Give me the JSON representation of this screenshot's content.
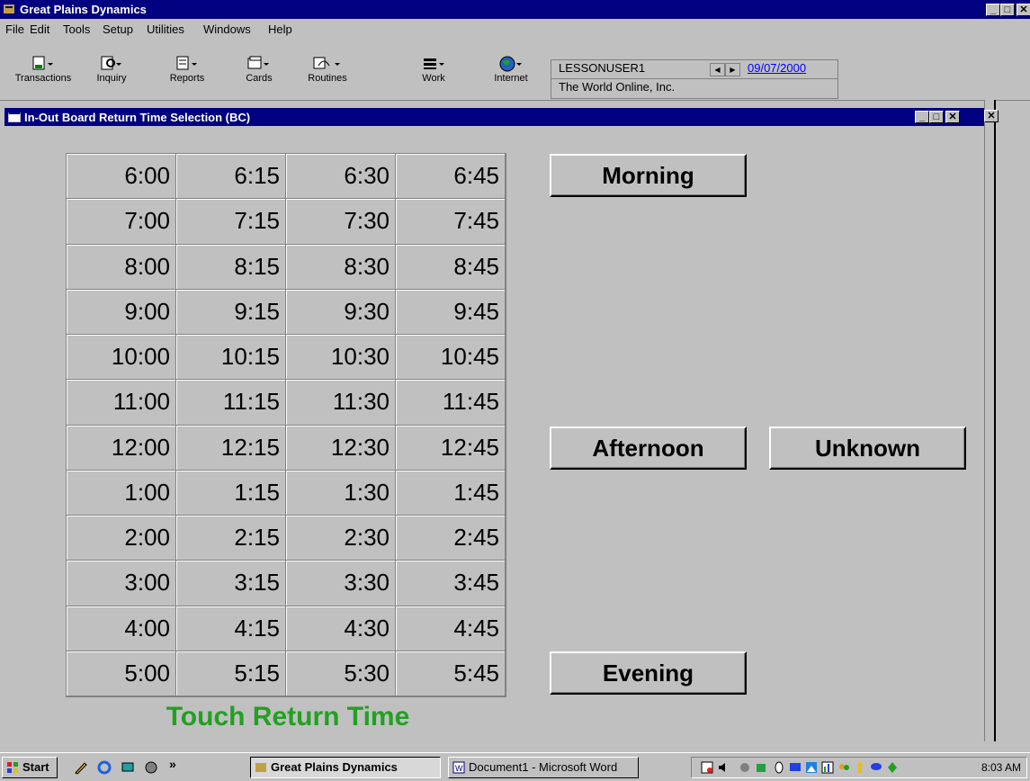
{
  "app": {
    "title": "Great Plains Dynamics",
    "min_glyph": "_",
    "max_glyph": "□",
    "close_glyph": "✕"
  },
  "menu": [
    {
      "label": "File"
    },
    {
      "label": "Edit"
    },
    {
      "label": "Tools"
    },
    {
      "label": "Setup"
    },
    {
      "label": "Utilities"
    },
    {
      "label": "Windows"
    },
    {
      "label": "Help"
    }
  ],
  "toolbar": {
    "buttons": [
      {
        "label": "Transactions",
        "icon": "transactions-icon"
      },
      {
        "label": "Inquiry",
        "icon": "inquiry-icon"
      },
      {
        "label": "Reports",
        "icon": "reports-icon"
      },
      {
        "label": "Cards",
        "icon": "cards-icon"
      },
      {
        "label": "Routines",
        "icon": "routines-icon"
      },
      {
        "label": "Work",
        "icon": "work-icon"
      },
      {
        "label": "Internet",
        "icon": "globe-icon"
      }
    ],
    "user": "LESSONUSER1",
    "date": "09/07/2000",
    "company": "The World Online, Inc."
  },
  "window": {
    "title": "In-Out Board Return Time Selection (BC)"
  },
  "times": [
    [
      "6:00",
      "6:15",
      "6:30",
      "6:45"
    ],
    [
      "7:00",
      "7:15",
      "7:30",
      "7:45"
    ],
    [
      "8:00",
      "8:15",
      "8:30",
      "8:45"
    ],
    [
      "9:00",
      "9:15",
      "9:30",
      "9:45"
    ],
    [
      "10:00",
      "10:15",
      "10:30",
      "10:45"
    ],
    [
      "11:00",
      "11:15",
      "11:30",
      "11:45"
    ],
    [
      "12:00",
      "12:15",
      "12:30",
      "12:45"
    ],
    [
      "1:00",
      "1:15",
      "1:30",
      "1:45"
    ],
    [
      "2:00",
      "2:15",
      "2:30",
      "2:45"
    ],
    [
      "3:00",
      "3:15",
      "3:30",
      "3:45"
    ],
    [
      "4:00",
      "4:15",
      "4:30",
      "4:45"
    ],
    [
      "5:00",
      "5:15",
      "5:30",
      "5:45"
    ]
  ],
  "buttons": {
    "morning": "Morning",
    "afternoon": "Afternoon",
    "unknown": "Unknown",
    "evening": "Evening"
  },
  "touch_label": "Touch Return Time",
  "taskbar": {
    "start": "Start",
    "chevron": "»",
    "tasks": [
      {
        "label": "Great Plains Dynamics",
        "active": true
      },
      {
        "label": "Document1 - Microsoft Word",
        "active": false
      }
    ],
    "clock": "8:03 AM"
  },
  "colors": {
    "title_bar": "#000080",
    "touch_label": "#22a022",
    "date_link": "#0000ff",
    "face": "#c0c0c0"
  }
}
